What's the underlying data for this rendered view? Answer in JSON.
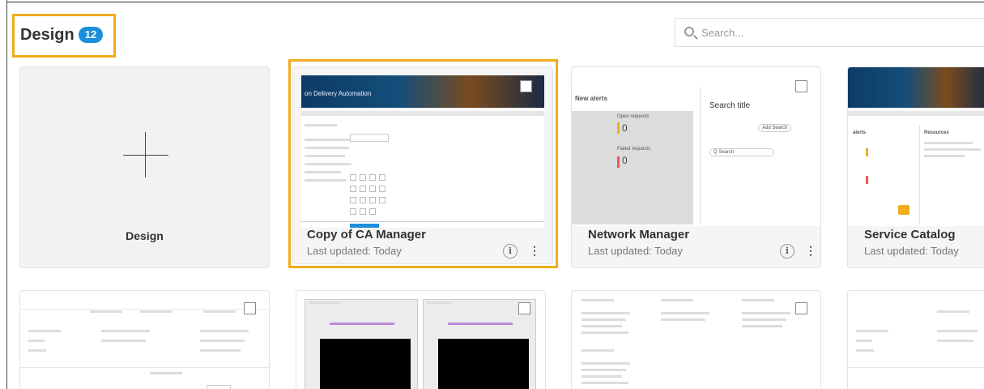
{
  "header": {
    "title": "Design",
    "count": "12",
    "search_placeholder": "Search..."
  },
  "create_card": {
    "label": "Design"
  },
  "cards": [
    {
      "name": "Copy of CA Manager",
      "updated": "Last updated: Today",
      "thumb_banner": "on Delivery Automation"
    },
    {
      "name": "Network Manager",
      "updated": "Last updated: Today",
      "thumb_heading": "New alerts",
      "thumb_search_title": "Search title",
      "thumb_open": "Open requests",
      "thumb_open_count": "0",
      "thumb_failed": "Failed requests",
      "thumb_failed_count": "0",
      "thumb_search": "Q Search",
      "thumb_add": "Add Search"
    },
    {
      "name": "Service Catalog",
      "updated": "Last updated: Today",
      "thumb_alerts": "alerts",
      "thumb_resources": "Resources"
    }
  ],
  "icons": {
    "info": "i",
    "more": "⋮"
  },
  "colors": {
    "highlight": "#f0ad1e",
    "badge": "#1b8fdc"
  }
}
